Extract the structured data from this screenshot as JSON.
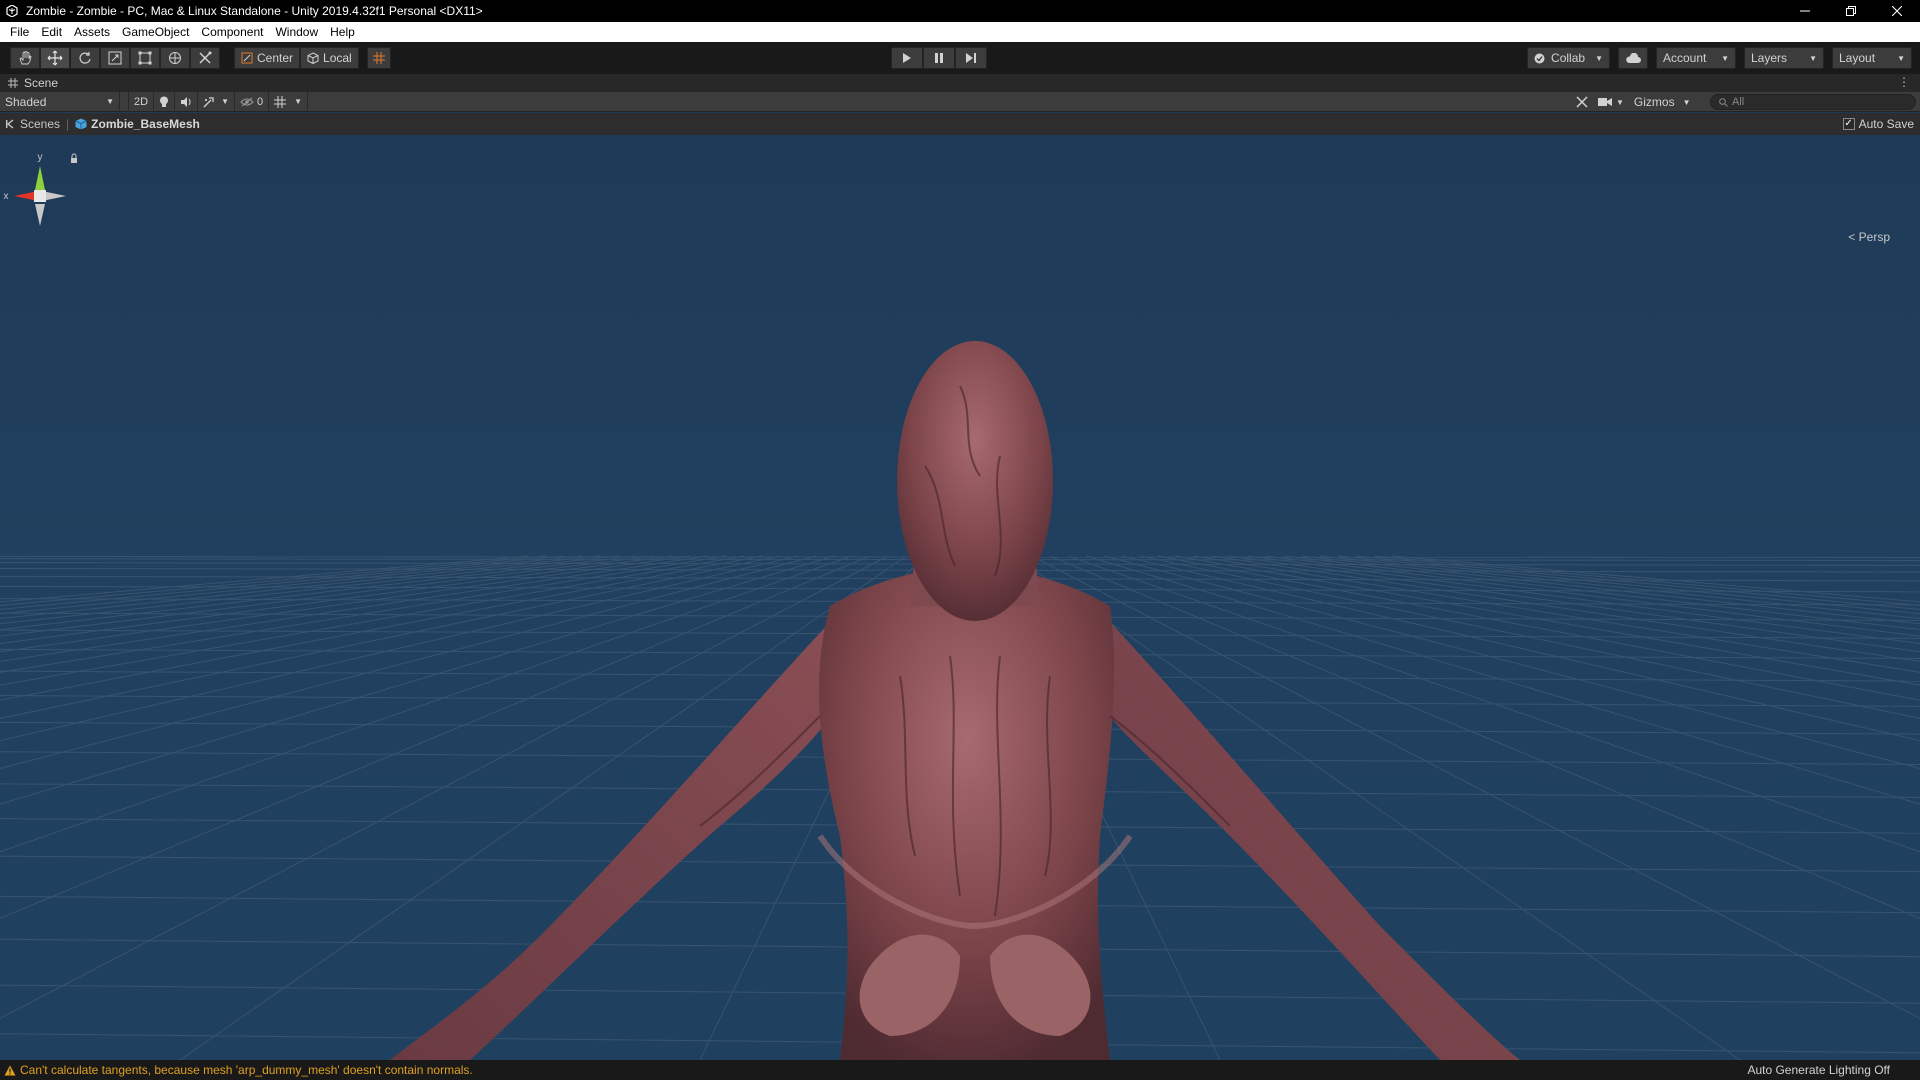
{
  "window": {
    "title": "Zombie - Zombie - PC, Mac & Linux Standalone - Unity 2019.4.32f1 Personal <DX11>",
    "controls": [
      "minimize",
      "restore",
      "close"
    ]
  },
  "menu": {
    "items": [
      "File",
      "Edit",
      "Assets",
      "GameObject",
      "Component",
      "Window",
      "Help"
    ]
  },
  "toolbar": {
    "tools": [
      "hand-tool",
      "move-tool",
      "rotate-tool",
      "scale-tool",
      "rect-tool",
      "transform-tool",
      "custom-tool"
    ],
    "active_tool": "move-tool",
    "pivot_mode": "Center",
    "pivot_rotation": "Local",
    "collab_label": "Collab",
    "account_label": "Account",
    "layers_label": "Layers",
    "layout_label": "Layout"
  },
  "scene_tab": {
    "label": "Scene"
  },
  "scene_toolbar": {
    "draw_mode": "Shaded",
    "mode_2d": "2D",
    "hidden_count": "0",
    "gizmos_label": "Gizmos",
    "search_placeholder": "All"
  },
  "breadcrumb": {
    "root": "Scenes",
    "current": "Zombie_BaseMesh",
    "auto_save_label": "Auto Save",
    "auto_save_checked": true
  },
  "viewport": {
    "projection_label": "Persp",
    "axis_labels": {
      "x": "x",
      "y": "y"
    },
    "colors": {
      "background": "#1f3a57",
      "grid": "#3f5a76",
      "axis_x": "#e0352b",
      "axis_y": "#8ed13a"
    }
  },
  "status": {
    "warning": "Can't calculate tangents, because mesh 'arp_dummy_mesh' doesn't contain normals.",
    "lighting": "Auto Generate Lighting Off",
    "warning_color": "#e0a020"
  }
}
